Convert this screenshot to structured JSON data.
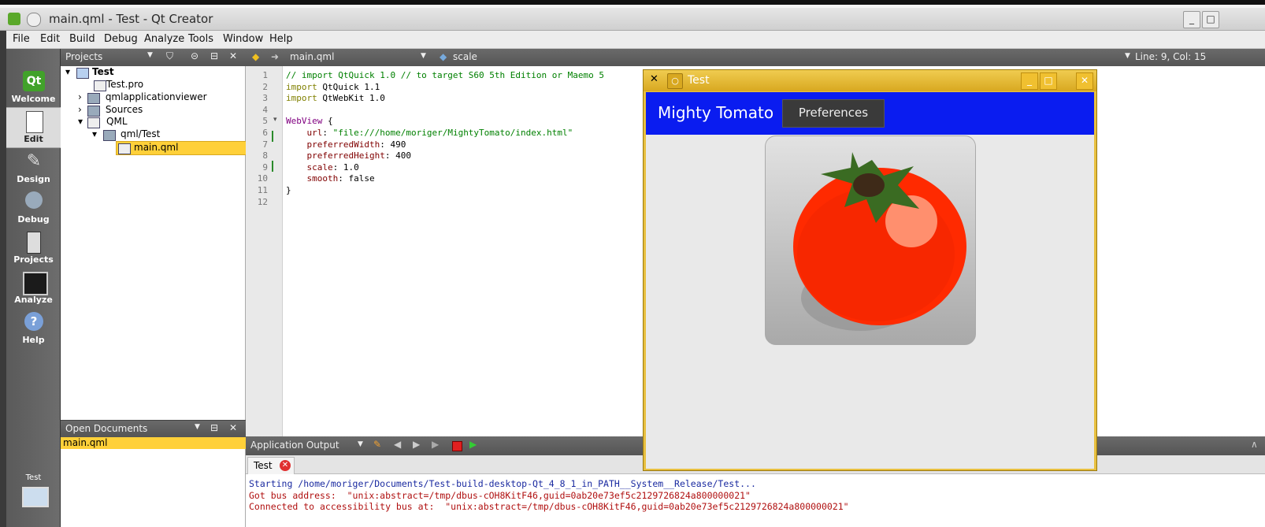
{
  "window": {
    "title": "main.qml - Test - Qt Creator"
  },
  "menu": [
    "File",
    "Edit",
    "Build",
    "Debug",
    "Analyze",
    "Tools",
    "Window",
    "Help"
  ],
  "modes": [
    {
      "label": "Welcome",
      "icon": "qt-logo-icon"
    },
    {
      "label": "Edit",
      "icon": "edit-document-icon"
    },
    {
      "label": "Design",
      "icon": "design-pen-icon"
    },
    {
      "label": "Debug",
      "icon": "debug-bug-icon"
    },
    {
      "label": "Projects",
      "icon": "projects-icon"
    },
    {
      "label": "Analyze",
      "icon": "analyze-monitor-icon"
    },
    {
      "label": "Help",
      "icon": "help-icon"
    }
  ],
  "target": {
    "label": "Test"
  },
  "projects": {
    "header": "Projects",
    "tree": [
      {
        "label": "Test",
        "bold": true
      },
      {
        "label": "Test.pro"
      },
      {
        "label": "qmlapplicationviewer"
      },
      {
        "label": "Sources"
      },
      {
        "label": "QML"
      },
      {
        "label": "qml/Test"
      },
      {
        "label": "main.qml",
        "selected": true
      }
    ]
  },
  "open_documents": {
    "header": "Open Documents",
    "items": [
      "main.qml"
    ]
  },
  "editor": {
    "file": "main.qml",
    "symbol": "scale",
    "position": "Line: 9, Col: 15",
    "line_numbers": [
      "1",
      "2",
      "3",
      "4",
      "5",
      "6",
      "7",
      "8",
      "9",
      "10",
      "11",
      "12"
    ],
    "code": [
      "// import QtQuick 1.0 // to target S60 5th Edition or Maemo 5",
      "import QtQuick 1.1",
      "import QtWebKit 1.0",
      "",
      "WebView {",
      "    url: \"file:///home/moriger/MightyTomato/index.html\"",
      "    preferredWidth: 490",
      "    preferredHeight: 400",
      "    scale: 1.0",
      "    smooth: false",
      "}",
      ""
    ]
  },
  "output": {
    "header": "Application Output",
    "tab": "Test",
    "lines": [
      "Starting /home/moriger/Documents/Test-build-desktop-Qt_4_8_1_in_PATH__System__Release/Test...",
      "Got bus address:  \"unix:abstract=/tmp/dbus-cOH8KitF46,guid=0ab20e73ef5c2129726824a800000021\"",
      "Connected to accessibility bus at:  \"unix:abstract=/tmp/dbus-cOH8KitF46,guid=0ab20e73ef5c2129726824a800000021\""
    ]
  },
  "test_window": {
    "title": "Test",
    "app_title": "Mighty Tomato",
    "preferences_button": "Preferences"
  },
  "colors": {
    "accent": "#ffd039",
    "blue_bar": "#0a1cf0",
    "tomato": "#ff2a00"
  }
}
